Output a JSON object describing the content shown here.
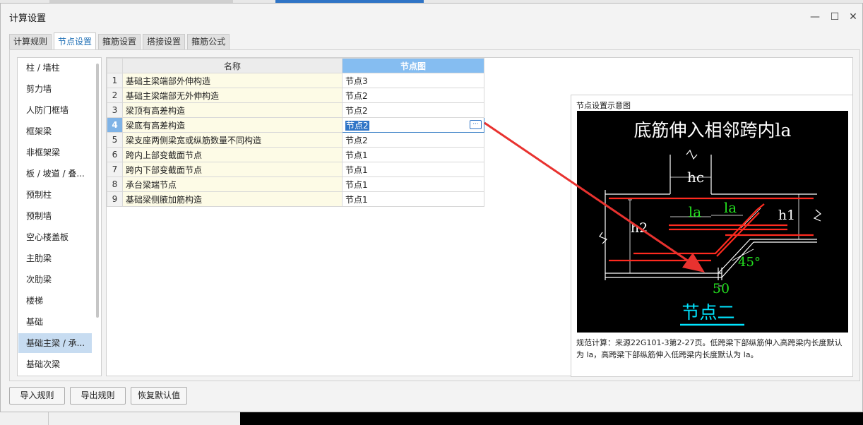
{
  "dialog": {
    "title": "计算设置",
    "minimize_glyph": "—",
    "maximize_glyph": "☐",
    "close_glyph": "✕"
  },
  "tabs": [
    {
      "label": "计算规则"
    },
    {
      "label": "节点设置"
    },
    {
      "label": "箍筋设置"
    },
    {
      "label": "搭接设置"
    },
    {
      "label": "箍筋公式"
    }
  ],
  "sidebar": {
    "items": [
      {
        "label": "柱 / 墙柱"
      },
      {
        "label": "剪力墙"
      },
      {
        "label": "人防门框墙"
      },
      {
        "label": "框架梁"
      },
      {
        "label": "非框架梁"
      },
      {
        "label": "板 / 坡道 / 叠..."
      },
      {
        "label": "预制柱"
      },
      {
        "label": "预制墙"
      },
      {
        "label": "空心楼盖板"
      },
      {
        "label": "主肋梁"
      },
      {
        "label": "次肋梁"
      },
      {
        "label": "楼梯"
      },
      {
        "label": "基础"
      },
      {
        "label": "基础主梁 / 承..."
      },
      {
        "label": "基础次梁"
      }
    ],
    "selected_index": 13
  },
  "grid": {
    "headers": {
      "name": "名称",
      "node": "节点图"
    },
    "rows": [
      {
        "num": "1",
        "name": "基础主梁端部外伸构造",
        "value": "节点3"
      },
      {
        "num": "2",
        "name": "基础主梁端部无外伸构造",
        "value": "节点2"
      },
      {
        "num": "3",
        "name": "梁顶有高差构造",
        "value": "节点2"
      },
      {
        "num": "4",
        "name": "梁底有高差构造",
        "value": "节点2"
      },
      {
        "num": "5",
        "name": "梁支座两侧梁宽或纵筋数量不同构造",
        "value": "节点2"
      },
      {
        "num": "6",
        "name": "跨内上部变截面节点",
        "value": "节点1"
      },
      {
        "num": "7",
        "name": "跨内下部变截面节点",
        "value": "节点1"
      },
      {
        "num": "8",
        "name": "承台梁端节点",
        "value": "节点1"
      },
      {
        "num": "9",
        "name": "基础梁侧腋加筋构造",
        "value": "节点1"
      }
    ],
    "editing_row": 3,
    "edit_button_glyph": "···"
  },
  "diagram": {
    "label": "节点设置示意图",
    "title": "底筋伸入相邻跨内la",
    "labels": {
      "hc": "hc",
      "h2": "h2",
      "h1": "h1",
      "la_left": "la",
      "la_right": "la",
      "angle": "45°",
      "fifty": "50",
      "node_name": "节点二"
    },
    "description": "规范计算：来源22G101-3第2-27页。低跨梁下部纵筋伸入高跨梁内长度默认为 la，高跨梁下部纵筋伸入低跨梁内长度默认为 la。"
  },
  "buttons": {
    "import": "导入规则",
    "export": "导出规则",
    "restore": "恢复默认值"
  },
  "colors": {
    "accent_blue": "#85bdf1",
    "selection_blue": "#2f74c6",
    "arrow_red": "#e8322f",
    "rebar_red": "#ff2a1f",
    "label_green": "#23e01f",
    "underline_cyan": "#00e5ff"
  }
}
